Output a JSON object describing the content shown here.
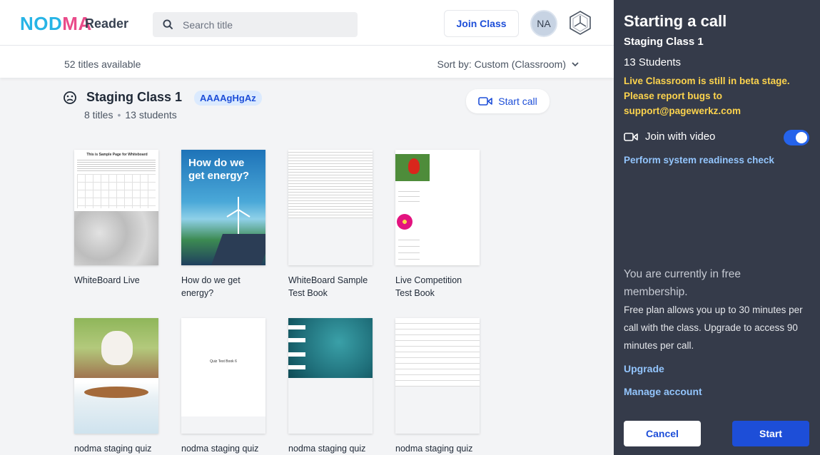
{
  "header": {
    "logo": "NODMA",
    "app_name": "Reader",
    "search_placeholder": "Search title",
    "join_class_label": "Join Class",
    "avatar_initials": "NA"
  },
  "subbar": {
    "count_text": "52 titles available",
    "sort_text": "Sort by: Custom (Classroom)"
  },
  "class": {
    "name": "Staging Class 1",
    "code": "AAAAgHgAz",
    "titles": "8 titles",
    "students": "13 students",
    "start_call_label": "Start call"
  },
  "books": [
    {
      "title": "WhiteBoard Live"
    },
    {
      "title": "How do we get energy?"
    },
    {
      "title": "WhiteBoard Sample Test Book"
    },
    {
      "title": "Live Competition Test Book"
    },
    {
      "title": "nodma staging quiz"
    },
    {
      "title": "nodma staging quiz"
    },
    {
      "title": "nodma staging quiz"
    },
    {
      "title": "nodma staging quiz"
    }
  ],
  "cover_text": {
    "energy": "How do we get energy?",
    "whiteboard_heading": "This is Sample Page for Whiteboard",
    "quiz": "Quiz Test Book 6"
  },
  "panel": {
    "title": "Starting a call",
    "class_name": "Staging Class 1",
    "students": "13 Students",
    "beta_notice": "Live Classroom is still in beta stage. Please report bugs to support@pagewerkz.com",
    "join_video_label": "Join with video",
    "join_video_on": true,
    "readiness_check": "Perform system readiness check",
    "free_membership": "You are currently in free membership.",
    "plan_info": "Free plan allows you up to 30 minutes per call with the class. Upgrade to access 90 minutes per call.",
    "upgrade_label": "Upgrade",
    "manage_label": "Manage account",
    "cancel_label": "Cancel",
    "start_label": "Start"
  },
  "colors": {
    "accent": "#1d4ed8",
    "panel_bg": "#353b4a",
    "beta_text": "#fcd34d",
    "logo_blue": "#27b4e6",
    "logo_pink": "#e94b8a"
  }
}
